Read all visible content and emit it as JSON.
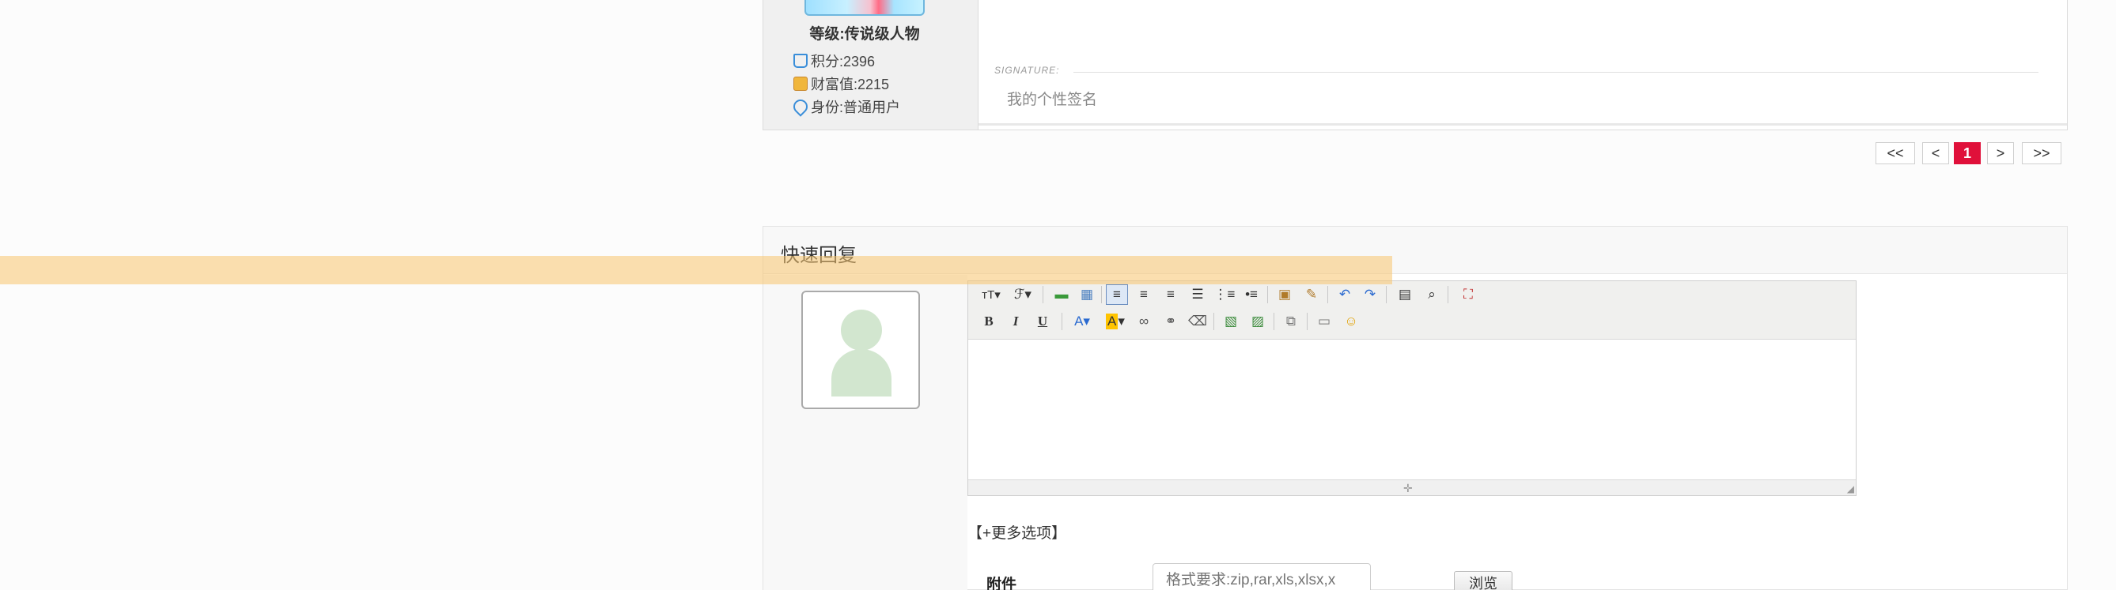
{
  "post": {
    "level": "等级:传说级人物",
    "stats": [
      {
        "icon": "cart-icon",
        "text": "积分:2396"
      },
      {
        "icon": "coin-icon",
        "text": "财富值:2215"
      },
      {
        "icon": "heart-icon",
        "text": "身份:普通用户"
      }
    ],
    "signature_label": "SIGNATURE:",
    "signature_text": "我的个性签名"
  },
  "pagination": {
    "first": "<<",
    "prev": "<",
    "current": "1",
    "next": ">",
    "last": ">>"
  },
  "quick_reply": {
    "title": "快速回复",
    "more_options": "【+更多选项】",
    "attachment_label": "附件",
    "attachment_placeholder": "格式要求:zip,rar,xls,xlsx,x",
    "browse_label": "浏览"
  },
  "editor_toolbar": {
    "row1": [
      "font-size-icon",
      "font-family-icon",
      "insert-row-icon",
      "table-icon",
      "align-left-icon",
      "align-center-icon",
      "align-right-icon",
      "align-justify-icon",
      "ordered-list-icon",
      "unordered-list-icon",
      "paste-icon",
      "paste-word-icon",
      "undo-icon",
      "redo-icon",
      "source-icon",
      "preview-icon",
      "fullscreen-icon"
    ],
    "row2": [
      "bold-icon",
      "italic-icon",
      "underline-icon",
      "font-color-icon",
      "highlight-color-icon",
      "link-icon",
      "unlink-icon",
      "eraser-icon",
      "image-icon",
      "multi-image-icon",
      "attachment-icon",
      "video-icon",
      "emoji-icon"
    ]
  },
  "colors": {
    "accent_red": "#e0103a",
    "overlay": "#f8c46e"
  }
}
